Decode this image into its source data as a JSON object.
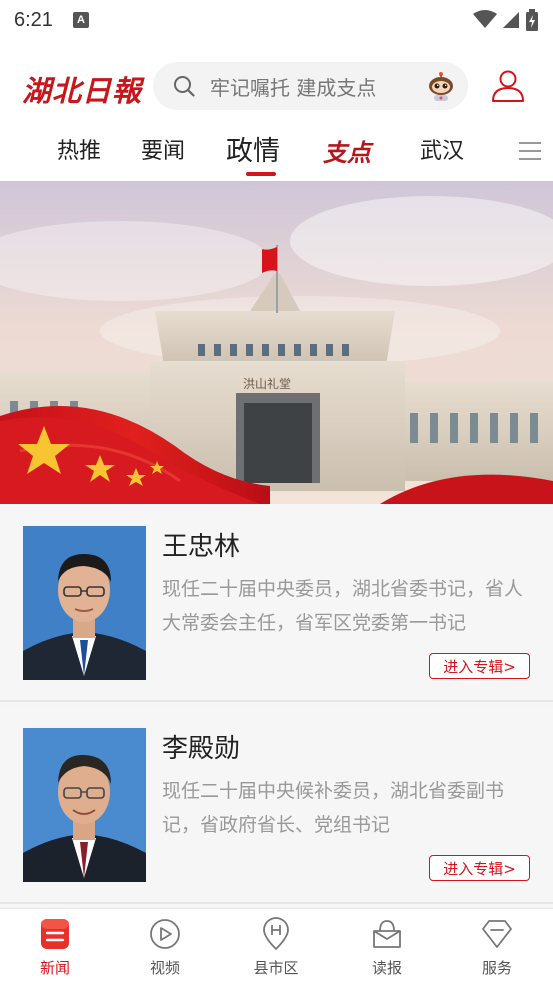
{
  "status_bar": {
    "time": "6:21",
    "indicator": "A"
  },
  "header": {
    "logo_text": "湖北日報",
    "search_placeholder": "牢记嘱托 建成支点"
  },
  "tabs": [
    {
      "label": "热推"
    },
    {
      "label": "要闻"
    },
    {
      "label": "政情"
    },
    {
      "label": "支点"
    },
    {
      "label": "武汉"
    }
  ],
  "active_tab_index": 2,
  "banner": {
    "building_sign": "洪山礼堂"
  },
  "cards": [
    {
      "name": "王忠林",
      "description": "现任二十届中央委员，湖北省委书记，省人大常委会主任，省军区党委第一书记",
      "button_label": "进入专辑>"
    },
    {
      "name": "李殿勋",
      "description": "现任二十届中央候补委员，湖北省委副书记，省政府省长、党组书记",
      "button_label": "进入专辑>"
    }
  ],
  "bottom_nav": [
    {
      "label": "新闻",
      "icon": "news-icon",
      "active": true
    },
    {
      "label": "视频",
      "icon": "video-icon",
      "active": false
    },
    {
      "label": "县市区",
      "icon": "county-icon",
      "active": false
    },
    {
      "label": "读报",
      "icon": "newspaper-icon",
      "active": false
    },
    {
      "label": "服务",
      "icon": "service-icon",
      "active": false
    }
  ],
  "colors": {
    "brand_red": "#d4141b",
    "text_gray": "#999999"
  }
}
